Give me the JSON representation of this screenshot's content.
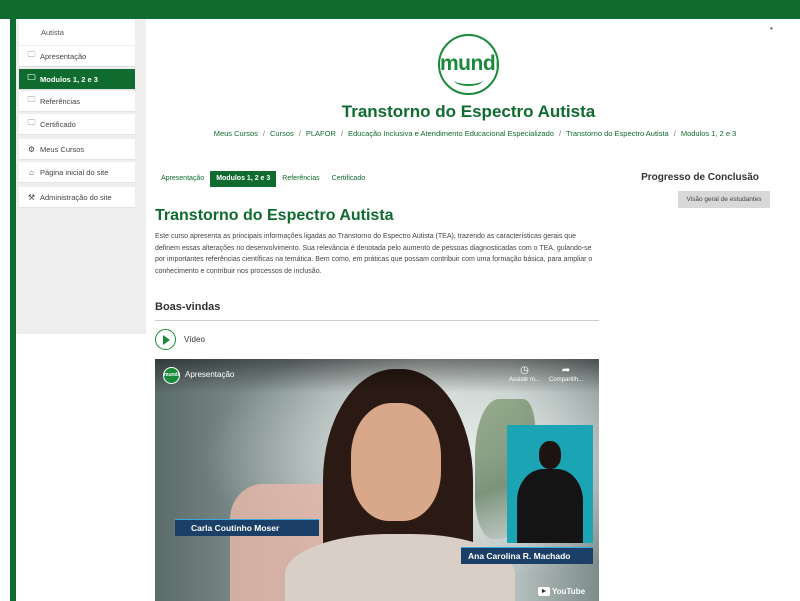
{
  "sidebar": {
    "header_partial": "Autista",
    "items": [
      {
        "label": "Apresentação",
        "icon": "folder-icon",
        "active": false
      },
      {
        "label": "Modulos 1, 2 e 3",
        "icon": "folder-icon",
        "active": true
      },
      {
        "label": "Referências",
        "icon": "folder-icon",
        "active": false
      },
      {
        "label": "Certificado",
        "icon": "folder-icon",
        "active": false
      }
    ],
    "nav": [
      {
        "label": "Meus Cursos",
        "icon": "courses-icon"
      },
      {
        "label": "Página inicial do site",
        "icon": "home-icon"
      },
      {
        "label": "Administração do site",
        "icon": "wrench-icon"
      }
    ]
  },
  "brand": {
    "logo_text": "mundi",
    "color": "#1a8a3a"
  },
  "header": {
    "title": "Transtorno do Espectro Autista",
    "breadcrumb": [
      "Meus Cursos",
      "Cursos",
      "PLAFOR",
      "Educação Inclusiva e Atendimento Educacional Especializado",
      "Transtorno do Espectro Autista",
      "Modulos 1, 2 e 3"
    ]
  },
  "tabs": [
    {
      "label": "Apresentação",
      "active": false
    },
    {
      "label": "Modulos 1, 2 e 3",
      "active": true
    },
    {
      "label": "Referências",
      "active": false
    },
    {
      "label": "Certificado",
      "active": false
    }
  ],
  "progress": {
    "title": "Progresso de Conclusão",
    "overview_button": "Visão geral de estudantes"
  },
  "course": {
    "title": "Transtorno do Espectro Autista",
    "description": "Este curso apresenta as principais informações ligadas ao Transtorno do Espectro Autista (TEA), trazendo as características gerais que definem essas alterações no desenvolvimento. Sua relevância é denotada pelo aumento de pessoas diagnosticadas com o TEA, gulando-se por importantes referências científicas na temática. Bem como, em práticas que possam contribuir com uma formação básica, para ampliar o conhecimento e contribuir nos processos de inclusão."
  },
  "section": {
    "title": "Boas-vindas",
    "video_label": "Vídeo"
  },
  "video": {
    "channel_badge": "mundi",
    "title": "Apresentação",
    "watch_later": "Assistir m...",
    "share": "Compartilh...",
    "speaker_name": "Carla Coutinho Moser",
    "interpreter_name": "Ana Carolina R. Machado",
    "platform": "YouTube"
  },
  "colors": {
    "primary": "#0f6b2e",
    "accent": "#1a8a3a"
  }
}
